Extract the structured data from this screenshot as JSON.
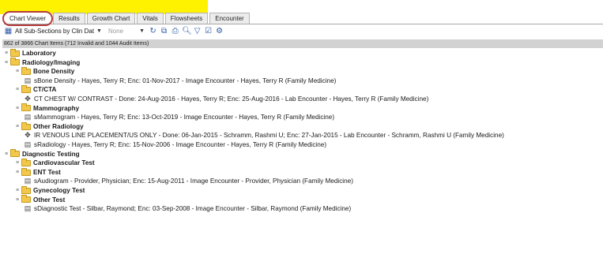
{
  "tabs": [
    "Chart Viewer",
    "Results",
    "Growth Chart",
    "Vitals",
    "Flowsheets",
    "Encounter"
  ],
  "toolbar": {
    "section_filter": "All Sub-Sections by Clin Dat",
    "secondary_filter": "None"
  },
  "status": "862 of 3866 Chart Items (712 Invalid and 1044 Audit Items)",
  "tree": [
    {
      "level": 0,
      "type": "folder",
      "bold": true,
      "text": "Laboratory"
    },
    {
      "level": 0,
      "type": "folder",
      "bold": true,
      "text": "Radiology/Imaging"
    },
    {
      "level": 1,
      "type": "folder",
      "bold": true,
      "text": "Bone Density"
    },
    {
      "level": 2,
      "type": "doc",
      "icon": "scanned-document-icon",
      "text": "sBone Density - Hayes, Terry R; Enc: 01-Nov-2017 - Image Encounter - Hayes, Terry R (Family Medicine)"
    },
    {
      "level": 1,
      "type": "folder",
      "bold": true,
      "text": "CT/CTA"
    },
    {
      "level": 2,
      "type": "doc",
      "icon": "lab-result-icon",
      "text": "CT CHEST W/ CONTRAST - Done: 24-Aug-2016 - Hayes, Terry R; Enc: 25-Aug-2016 - Lab Encounter - Hayes, Terry R (Family Medicine)"
    },
    {
      "level": 1,
      "type": "folder",
      "bold": true,
      "text": "Mammography"
    },
    {
      "level": 2,
      "type": "doc",
      "icon": "scanned-document-icon",
      "text": "sMammogram - Hayes, Terry R; Enc: 13-Oct-2019 - Image Encounter - Hayes, Terry R (Family Medicine)"
    },
    {
      "level": 1,
      "type": "folder",
      "bold": true,
      "text": "Other Radiology"
    },
    {
      "level": 2,
      "type": "doc",
      "icon": "lab-result-icon",
      "text": "IR VENOUS LINE PLACEMENT/US ONLY - Done: 06-Jan-2015 - Schramm, Rashmi U; Enc: 27-Jan-2015 - Lab Encounter - Schramm, Rashmi U (Family Medicine)"
    },
    {
      "level": 2,
      "type": "doc",
      "icon": "scanned-document-icon",
      "text": "sRadiology - Hayes, Terry R; Enc: 15-Nov-2006 - Image Encounter - Hayes, Terry R (Family Medicine)"
    },
    {
      "level": 0,
      "type": "folder",
      "bold": true,
      "text": "Diagnostic Testing"
    },
    {
      "level": 1,
      "type": "folder",
      "bold": true,
      "text": "Cardiovascular Test"
    },
    {
      "level": 1,
      "type": "folder",
      "bold": true,
      "text": "ENT Test"
    },
    {
      "level": 2,
      "type": "doc",
      "icon": "scanned-document-icon",
      "text": "sAudiogram - Provider, Physician; Enc: 15-Aug-2011 - Image Encounter - Provider, Physician (Family Medicine)"
    },
    {
      "level": 1,
      "type": "folder",
      "bold": true,
      "text": "Gynecology Test"
    },
    {
      "level": 1,
      "type": "folder",
      "bold": true,
      "text": "Other Test"
    },
    {
      "level": 2,
      "type": "doc",
      "icon": "document-icon",
      "text": "sDiagnostic Test - Silbar, Raymond; Enc: 03-Sep-2008 - Image Encounter - Silbar, Raymond (Family Medicine)"
    }
  ]
}
